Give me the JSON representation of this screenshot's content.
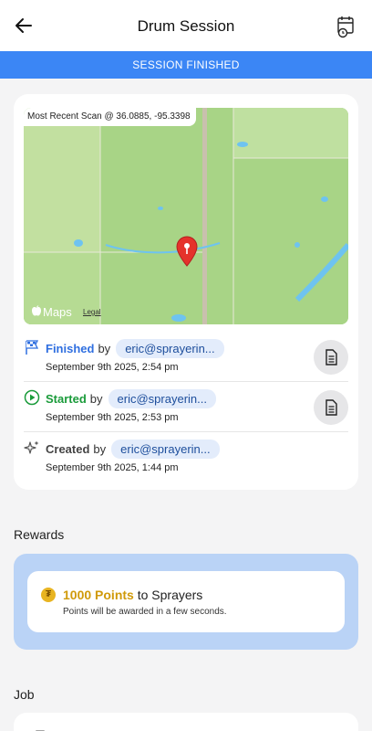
{
  "header": {
    "title": "Drum Session"
  },
  "banner": {
    "status_text": "SESSION FINISHED"
  },
  "map": {
    "caption": "Most Recent Scan @ 36.0885, -95.3398",
    "logo_text": "Maps",
    "legal_text": "Legal"
  },
  "events": [
    {
      "action": "Finished",
      "by": "by",
      "user": "eric@sprayerin...",
      "time": "September 9th 2025, 2:54 pm",
      "color": "#2f6fe0",
      "icon": "checkered-flag-icon"
    },
    {
      "action": "Started",
      "by": "by",
      "user": "eric@sprayerin...",
      "time": "September 9th 2025, 2:53 pm",
      "color": "#1a9b3a",
      "icon": "play-icon"
    },
    {
      "action": "Created",
      "by": "by",
      "user": "eric@sprayerin...",
      "time": "September 9th 2025, 1:44 pm",
      "color": "#444444",
      "icon": "sparkle-icon"
    }
  ],
  "rewards": {
    "section_title": "Rewards",
    "coin_symbol": "₮",
    "points_text": "1000 Points",
    "to_text": "to Sprayers",
    "note": "Points will be awarded in a few seconds."
  },
  "job": {
    "section_title": "Job"
  },
  "colors": {
    "accent": "#3b86f5",
    "reward_panel": "#bad3f6",
    "points": "#d09a0a"
  }
}
